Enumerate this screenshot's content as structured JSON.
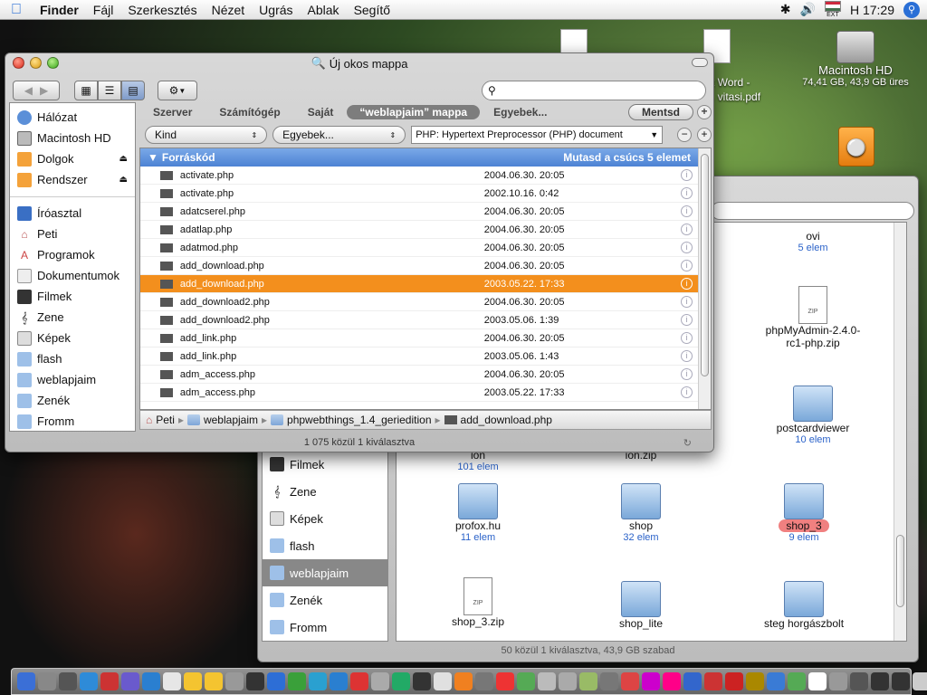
{
  "menubar": {
    "app": "Finder",
    "items": [
      "Fájl",
      "Szerkesztés",
      "Nézet",
      "Ugrás",
      "Ablak",
      "Segítő"
    ],
    "clock": "H 17:29",
    "flag_label": "EXT"
  },
  "desktop": {
    "hd_name": "Macintosh HD",
    "hd_info": "74,41 GB, 43,9 GB üres",
    "doc1_label": "t Word -",
    "doc2_label": ". vitasi.pdf"
  },
  "front": {
    "title": "Új okos mappa",
    "search": {
      "value": "",
      "placeholder": ""
    },
    "sidebar_devices": [
      {
        "label": "Hálózat",
        "icon": "globe-icon",
        "eject": false
      },
      {
        "label": "Macintosh HD",
        "icon": "hard-drive-icon",
        "eject": false
      },
      {
        "label": "Dolgok",
        "icon": "disk-icon",
        "eject": true
      },
      {
        "label": "Rendszer",
        "icon": "disk-icon",
        "eject": true
      }
    ],
    "sidebar_places": [
      {
        "label": "Íróasztal",
        "icon": "desktop-icon"
      },
      {
        "label": "Peti",
        "icon": "home-icon"
      },
      {
        "label": "Programok",
        "icon": "applications-icon"
      },
      {
        "label": "Dokumentumok",
        "icon": "documents-icon"
      },
      {
        "label": "Filmek",
        "icon": "movies-icon"
      },
      {
        "label": "Zene",
        "icon": "music-icon"
      },
      {
        "label": "Képek",
        "icon": "pictures-icon"
      },
      {
        "label": "flash",
        "icon": "folder-icon"
      },
      {
        "label": "weblapjaim",
        "icon": "folder-icon"
      },
      {
        "label": "Zenék",
        "icon": "folder-icon"
      },
      {
        "label": "Fromm",
        "icon": "folder-icon"
      }
    ],
    "scope": [
      "Szerver",
      "Számítógép",
      "Saját",
      "“weblapjaim” mappa",
      "Egyebek..."
    ],
    "scope_selected": 3,
    "save_label": "Mentsd",
    "criteria": {
      "attr": "Kind",
      "op": "Egyebek...",
      "value": "PHP: Hypertext Preprocessor (PHP) document"
    },
    "group": {
      "title": "Forráskód",
      "action": "Mutasd a csúcs 5 elemet"
    },
    "rows": [
      {
        "name": "activate.php",
        "date": "2004.06.30. 20:05"
      },
      {
        "name": "activate.php",
        "date": "2002.10.16. 0:42"
      },
      {
        "name": "adatcserel.php",
        "date": "2004.06.30. 20:05"
      },
      {
        "name": "adatlap.php",
        "date": "2004.06.30. 20:05"
      },
      {
        "name": "adatmod.php",
        "date": "2004.06.30. 20:05"
      },
      {
        "name": "add_download.php",
        "date": "2004.06.30. 20:05"
      },
      {
        "name": "add_download.php",
        "date": "2003.05.22. 17:33",
        "selected": true
      },
      {
        "name": "add_download2.php",
        "date": "2004.06.30. 20:05"
      },
      {
        "name": "add_download2.php",
        "date": "2003.05.06. 1:39"
      },
      {
        "name": "add_link.php",
        "date": "2004.06.30. 20:05"
      },
      {
        "name": "add_link.php",
        "date": "2003.05.06. 1:43"
      },
      {
        "name": "adm_access.php",
        "date": "2004.06.30. 20:05"
      },
      {
        "name": "adm_access.php",
        "date": "2003.05.22. 17:33"
      }
    ],
    "path": [
      "Peti",
      "weblapjaim",
      "phpwebthings_1.4_geriedition",
      "add_download.php"
    ],
    "status": "1 075 közül 1 kiválasztva"
  },
  "back": {
    "sidebar": [
      {
        "label": "Filmek",
        "icon": "movies-icon"
      },
      {
        "label": "Zene",
        "icon": "music-icon"
      },
      {
        "label": "Képek",
        "icon": "pictures-icon"
      },
      {
        "label": "flash",
        "icon": "folder-icon"
      },
      {
        "label": "weblapjaim",
        "icon": "folder-icon",
        "selected": true
      },
      {
        "label": "Zenék",
        "icon": "folder-icon"
      },
      {
        "label": "Fromm",
        "icon": "folder-icon"
      }
    ],
    "items": [
      {
        "name": "ovi",
        "count": "5 elem",
        "type": "folder"
      },
      {
        "name": "phpMyAdmin-2.4.0-rc1-php.zip",
        "count": "",
        "type": "zip"
      },
      {
        "name": "postcardviewer",
        "count": "10 elem",
        "type": "folder"
      },
      {
        "name": "ion",
        "count": "101 elem",
        "type": "partial"
      },
      {
        "name": "ion.zip",
        "count": "",
        "type": "partial"
      },
      {
        "name": "profox.hu",
        "count": "11 elem",
        "type": "folder"
      },
      {
        "name": "shop",
        "count": "32 elem",
        "type": "folder"
      },
      {
        "name": "shop_3",
        "count": "9 elem",
        "type": "folder",
        "highlight": true
      },
      {
        "name": "shop_3.zip",
        "count": "",
        "type": "zip"
      },
      {
        "name": "shop_lite",
        "count": "",
        "type": "folder"
      },
      {
        "name": "steg horgászbolt",
        "count": "",
        "type": "folder"
      }
    ],
    "status": "50 közül 1 kiválasztva, 43,9 GB szabad"
  },
  "colors": {
    "selection": "#f38f1d",
    "group_header": "#4c82d4",
    "label_red": "#f08080"
  }
}
